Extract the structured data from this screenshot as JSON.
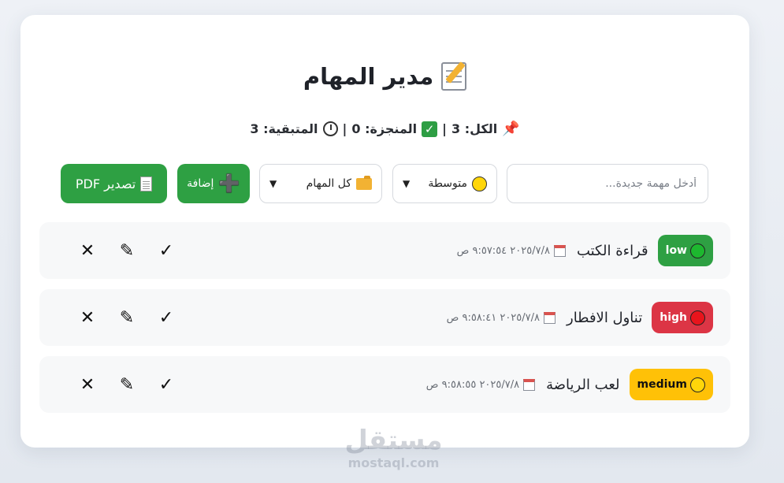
{
  "app": {
    "title": "مدير المهام"
  },
  "stats": {
    "total_label": "الكل: 3",
    "done_label": "المنجزة: 0",
    "remaining_label": "المتبقية: 3",
    "separator": "|"
  },
  "controls": {
    "input_placeholder": "أدخل مهمة جديدة...",
    "input_value": "",
    "priority_selected": "متوسطة",
    "filter_selected": "كل المهام",
    "add_label": "إضافة",
    "pdf_label": "تصدير PDF"
  },
  "tasks": [
    {
      "priority": "low",
      "text": "قراءة الكتب",
      "date": "٢٠٢٥/٧/٨ ٩:٥٧:٥٤ ص"
    },
    {
      "priority": "high",
      "text": "تناول الافطار",
      "date": "٢٠٢٥/٧/٨ ٩:٥٨:٤١ ص"
    },
    {
      "priority": "medium",
      "text": "لعب الرياضة",
      "date": "٢٠٢٥/٧/٨ ٩:٥٨:٥٥ ص"
    }
  ],
  "actions": {
    "complete_symbol": "✓",
    "edit_symbol": "✎",
    "delete_symbol": "✕"
  },
  "icons": {
    "title": "memo-icon",
    "total": "pin-icon",
    "done": "check-box-icon",
    "remaining": "clock-icon",
    "priority": "yellow-dot-icon",
    "filter": "folder-icon",
    "add": "plus-icon",
    "pdf": "doc-icon",
    "date": "calendar-icon"
  },
  "colors": {
    "accent_green": "#2ea043",
    "low": "#2ea043",
    "high": "#dc3545",
    "medium": "#ffc107",
    "low_dot": "#1db82f",
    "high_dot": "#e8141c",
    "medium_dot": "#ffd60a"
  },
  "watermark": {
    "arabic": "مستقل",
    "latin": "mostaql.com"
  }
}
